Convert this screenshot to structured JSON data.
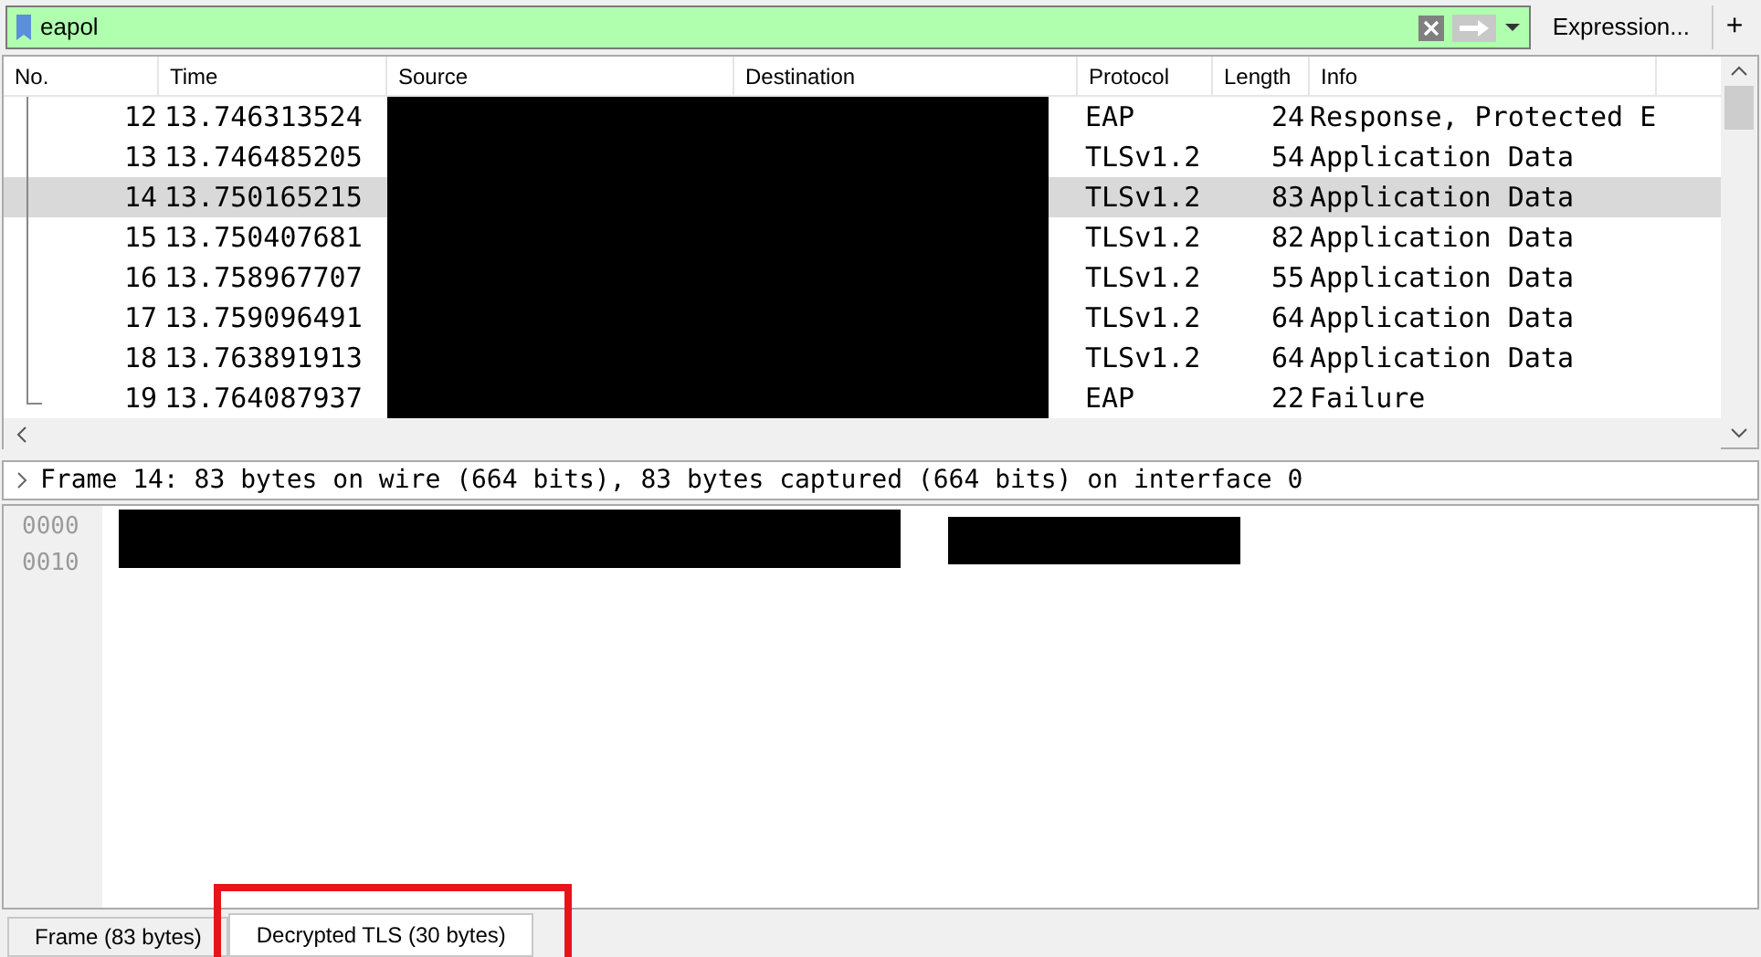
{
  "filter": {
    "value": "eapol",
    "button": "Expression...",
    "add": "+"
  },
  "packet_list": {
    "columns": [
      "No.",
      "Time",
      "Source",
      "Destination",
      "Protocol",
      "Length",
      "Info"
    ],
    "rows": [
      {
        "no": "12",
        "time": "13.746313524",
        "protocol": "EAP",
        "length": "24",
        "info": "Response, Protected E",
        "selected": false
      },
      {
        "no": "13",
        "time": "13.746485205",
        "protocol": "TLSv1.2",
        "length": "54",
        "info": "Application Data",
        "selected": false
      },
      {
        "no": "14",
        "time": "13.750165215",
        "protocol": "TLSv1.2",
        "length": "83",
        "info": "Application Data",
        "selected": true
      },
      {
        "no": "15",
        "time": "13.750407681",
        "protocol": "TLSv1.2",
        "length": "82",
        "info": "Application Data",
        "selected": false
      },
      {
        "no": "16",
        "time": "13.758967707",
        "protocol": "TLSv1.2",
        "length": "55",
        "info": "Application Data",
        "selected": false
      },
      {
        "no": "17",
        "time": "13.759096491",
        "protocol": "TLSv1.2",
        "length": "64",
        "info": "Application Data",
        "selected": false
      },
      {
        "no": "18",
        "time": "13.763891913",
        "protocol": "TLSv1.2",
        "length": "64",
        "info": "Application Data",
        "selected": false
      },
      {
        "no": "19",
        "time": "13.764087937",
        "protocol": "EAP",
        "length": "22",
        "info": "Failure",
        "selected": false
      }
    ]
  },
  "details": {
    "line": "Frame 14: 83 bytes on wire (664 bits), 83 bytes captured (664 bits) on interface 0"
  },
  "bytes": {
    "offsets": [
      "0000",
      "0010"
    ]
  },
  "tabs": [
    {
      "label": "Frame (83 bytes)",
      "selected": false
    },
    {
      "label": "Decrypted TLS (30 bytes)",
      "selected": true
    }
  ]
}
